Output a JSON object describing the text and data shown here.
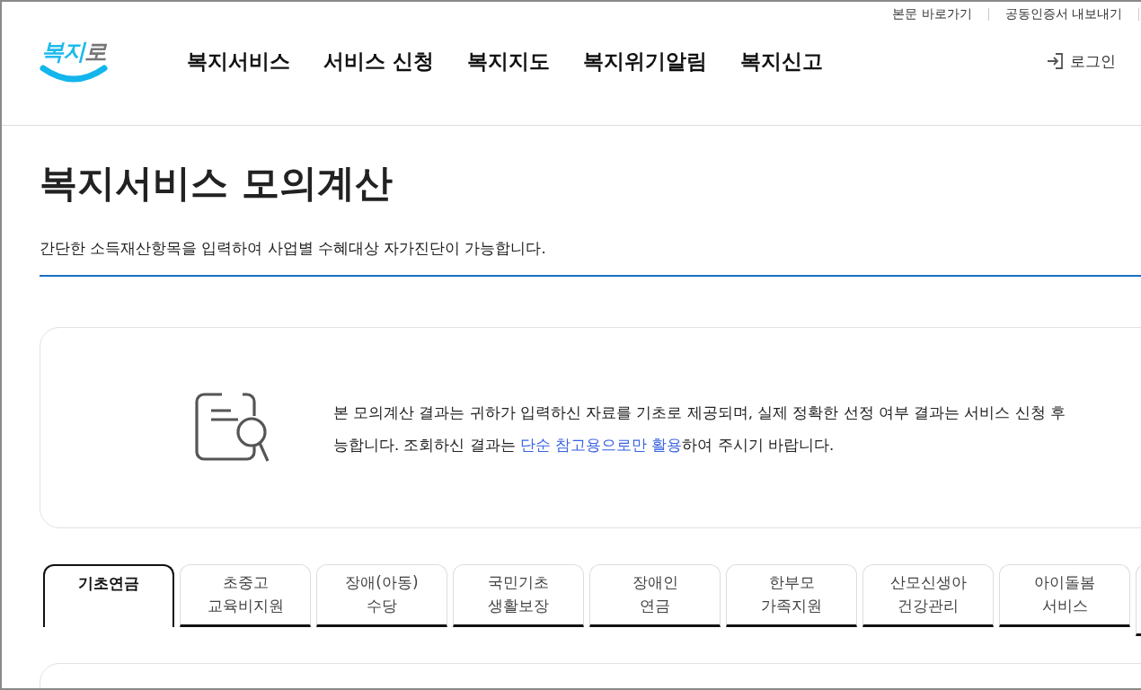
{
  "utility_links": [
    "본문 바로가기",
    "공동인증서 내보내기"
  ],
  "logo": [
    {
      "text": "복지",
      "color": "#1ebbec"
    },
    {
      "text": "로",
      "color": "#777777"
    }
  ],
  "nav": [
    "복지서비스",
    "서비스 신청",
    "복지지도",
    "복지위기알림",
    "복지신고"
  ],
  "login": "로그인",
  "page_title": "복지서비스 모의계산",
  "description": "간단한 소득재산항목을 입력하여 사업별 수혜대상 자가진단이 가능합니다.",
  "notice": {
    "line_1": [
      {
        "text": "본 모의계산 결과는 귀하가 입력하신 자료를 기초로 제공되며, 실제 정확한 선정 여부 결과는 서비스 신청 후",
        "highlight": false
      }
    ],
    "line_2": [
      {
        "text": "능합니다. 조회하신 결과는 ",
        "highlight": false
      },
      {
        "text": "단순 참고용으로만 활용",
        "highlight": true
      },
      {
        "text": "하여 주시기 바랍니다.",
        "highlight": false
      }
    ]
  },
  "tabs": [
    {
      "label": [
        "기초연금"
      ],
      "selected": true
    },
    {
      "label": [
        "초중고",
        "교육비지원"
      ],
      "selected": false
    },
    {
      "label": [
        "장애(아동)",
        "수당"
      ],
      "selected": false
    },
    {
      "label": [
        "국민기초",
        "생활보장"
      ],
      "selected": false
    },
    {
      "label": [
        "장애인",
        "연금"
      ],
      "selected": false
    },
    {
      "label": [
        "한부모",
        "가족지원"
      ],
      "selected": false
    },
    {
      "label": [
        "산모신생아",
        "건강관리"
      ],
      "selected": false
    },
    {
      "label": [
        "아이돌봄",
        "서비스"
      ],
      "selected": false
    }
  ]
}
